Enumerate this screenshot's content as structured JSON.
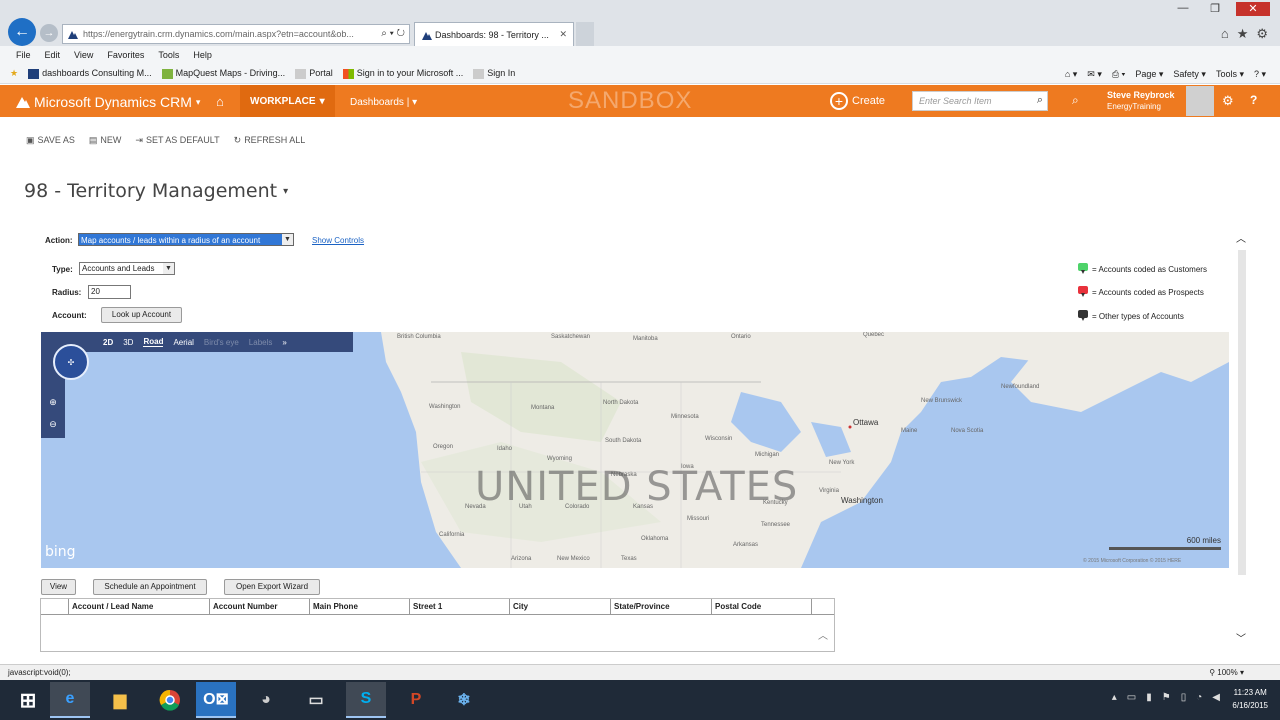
{
  "browser": {
    "url": "https://energytrain.crm.dynamics.com/main.aspx?etn=account&ob...",
    "tab_title": "Dashboards: 98 - Territory ...",
    "menu": [
      "File",
      "Edit",
      "View",
      "Favorites",
      "Tools",
      "Help"
    ],
    "favorites": [
      "dashboards Consulting M...",
      "MapQuest Maps - Driving...",
      "Portal",
      "Sign in to your Microsoft ...",
      "Sign In"
    ],
    "fav_tools": [
      "Page ▾",
      "Safety ▾",
      "Tools ▾"
    ],
    "window_controls": [
      "—",
      "❐",
      "✕"
    ]
  },
  "crm": {
    "app_name": "Microsoft Dynamics CRM",
    "area": "WORKPLACE",
    "section": "Dashboards",
    "watermark": "SANDBOX",
    "create_label": "Create",
    "search_placeholder": "Enter Search Item",
    "user_name": "Steve Reybrock",
    "org_name": "EnergyTraining",
    "help_label": "?"
  },
  "commands": {
    "save_as": "SAVE AS",
    "new": "NEW",
    "set_default": "SET AS DEFAULT",
    "refresh_all": "REFRESH ALL"
  },
  "page": {
    "title": "98 - Territory Management"
  },
  "territory": {
    "action_label": "Action:",
    "action_value": "Map accounts / leads within a radius of an account",
    "show_controls": "Show Controls",
    "type_label": "Type:",
    "type_value": "Accounts and Leads",
    "radius_label": "Radius:",
    "radius_value": "20",
    "account_label": "Account:",
    "lookup_label": "Look up Account",
    "legend": [
      {
        "text": "= Accounts coded as Customers",
        "color": "#4ed36a"
      },
      {
        "text": "= Accounts coded as Prospects",
        "color": "#e8323c"
      },
      {
        "text": "= Other types of Accounts",
        "color": "#333333"
      }
    ]
  },
  "map": {
    "modes": [
      "2D",
      "3D",
      "Road",
      "Aerial",
      "Bird's eye",
      "Labels"
    ],
    "country_label": "UNITED STATES",
    "labels": {
      "british_columbia": "British Columbia",
      "saskatchewan": "Saskatchewan",
      "manitoba": "Manitoba",
      "quebec": "Quebec",
      "ontario": "Ontario",
      "newfoundland": "Newfoundland",
      "washington": "Washington",
      "montana": "Montana",
      "north_dakota": "North Dakota",
      "minnesota": "Minnesota",
      "oregon": "Oregon",
      "idaho": "Idaho",
      "south_dakota": "South Dakota",
      "wyoming": "Wyoming",
      "wisconsin": "Wisconsin",
      "michigan": "Michigan",
      "ottawa": "Ottawa",
      "new_brunswick": "New Brunswick",
      "maine": "Maine",
      "nova_scotia": "Nova Scotia",
      "new_york": "New York",
      "nebraska": "Nebraska",
      "iowa": "Iowa",
      "nevada": "Nevada",
      "utah": "Utah",
      "colorado": "Colorado",
      "kansas": "Kansas",
      "california": "California",
      "missouri": "Missouri",
      "kentucky": "Kentucky",
      "virginia": "Virginia",
      "washington_dc": "Washington",
      "oklahoma": "Oklahoma",
      "tennessee": "Tennessee",
      "arizona": "Arizona",
      "new_mexico": "New Mexico",
      "texas": "Texas",
      "arkansas": "Arkansas"
    },
    "scale": "600 miles",
    "copyright": "© 2015 Microsoft Corporation © 2015 HERE",
    "bing": "bing"
  },
  "grid": {
    "buttons": {
      "view": "View",
      "schedule": "Schedule an Appointment",
      "export": "Open Export Wizard"
    },
    "columns": [
      "",
      "Account / Lead Name",
      "Account Number",
      "Main Phone",
      "Street 1",
      "City",
      "State/Province",
      "Postal Code"
    ]
  },
  "status": {
    "text": "javascript:void(0);",
    "zoom": "100%"
  },
  "taskbar": {
    "time": "11:23 AM",
    "date": "6/16/2015",
    "apps": [
      "internet-explorer",
      "file-explorer",
      "chrome",
      "outlook",
      "paint",
      "screen-capture",
      "skype",
      "powerpoint",
      "snipping"
    ]
  }
}
